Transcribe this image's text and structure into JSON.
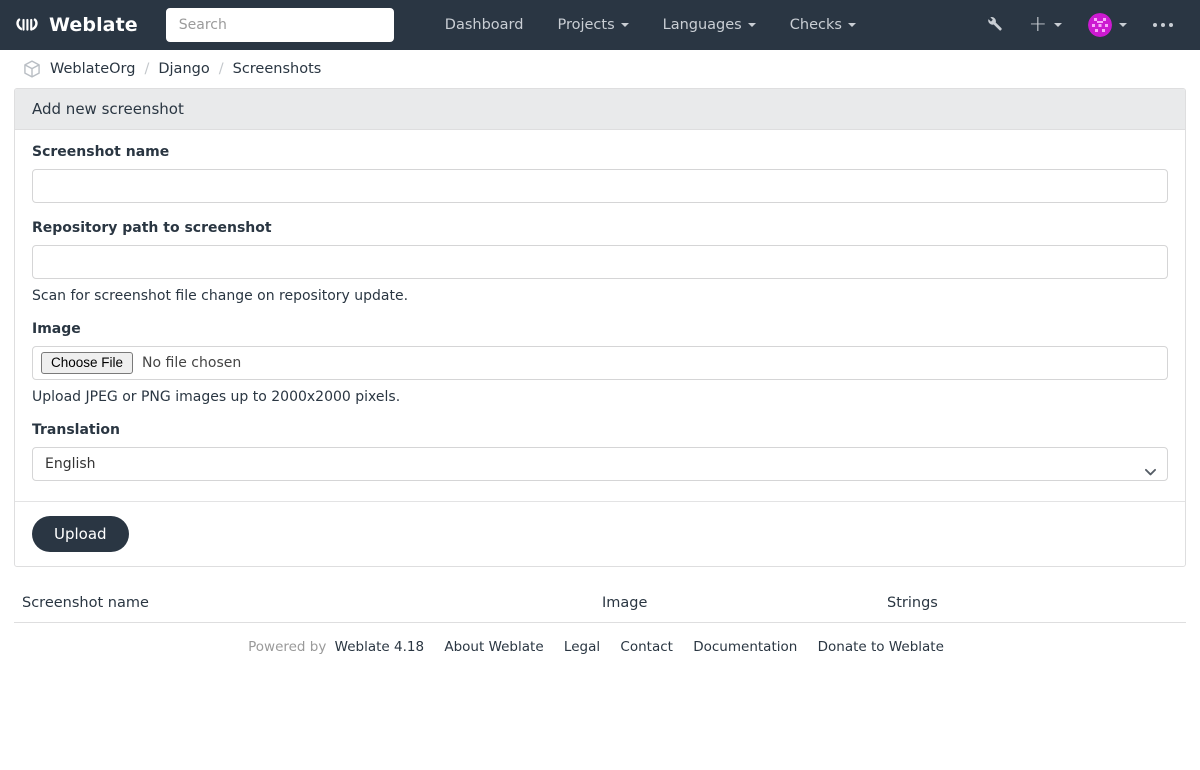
{
  "navbar": {
    "brand": "Weblate",
    "brand_icon": "weblate-logo-icon",
    "search_placeholder": "Search",
    "search_value": "",
    "links": [
      {
        "label": "Dashboard",
        "dropdown": false
      },
      {
        "label": "Projects",
        "dropdown": true
      },
      {
        "label": "Languages",
        "dropdown": true
      },
      {
        "label": "Checks",
        "dropdown": true
      }
    ],
    "tools_icon": "wrench-icon",
    "add_icon": "plus-icon",
    "avatar_icon": "user-avatar-identicon",
    "menu_icon": "ellipsis-icon",
    "bg_color": "#2a3643"
  },
  "breadcrumb": {
    "icon": "cube-icon",
    "items": [
      {
        "label": "WeblateOrg",
        "current": false
      },
      {
        "label": "Django",
        "current": false
      },
      {
        "label": "Screenshots",
        "current": true
      }
    ],
    "separator": "/"
  },
  "form_panel": {
    "title": "Add new screenshot",
    "fields": {
      "name": {
        "label": "Screenshot name",
        "value": "",
        "placeholder": ""
      },
      "repository_path": {
        "label": "Repository path to screenshot",
        "value": "",
        "placeholder": "",
        "help": "Scan for screenshot file change on repository update."
      },
      "image": {
        "label": "Image",
        "button_label": "Choose File",
        "file_status": "No file chosen",
        "help": "Upload JPEG or PNG images up to 2000x2000 pixels."
      },
      "translation": {
        "label": "Translation",
        "selected": "English",
        "options": [
          "English"
        ]
      }
    },
    "submit_label": "Upload",
    "submit_color": "#2a3643"
  },
  "screenshot_table": {
    "columns": [
      "Screenshot name",
      "Image",
      "Strings"
    ],
    "rows": []
  },
  "footer": {
    "powered_by": "Powered by",
    "links": [
      "Weblate 4.18",
      "About Weblate",
      "Legal",
      "Contact",
      "Documentation",
      "Donate to Weblate"
    ]
  }
}
